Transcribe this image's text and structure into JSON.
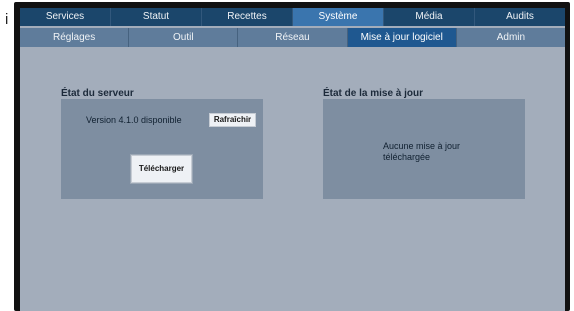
{
  "side_glyph": "i",
  "top_nav": {
    "tabs": [
      {
        "label": "Services",
        "active": false
      },
      {
        "label": "Statut",
        "active": false
      },
      {
        "label": "Recettes",
        "active": false
      },
      {
        "label": "Système",
        "active": true
      },
      {
        "label": "Média",
        "active": false
      },
      {
        "label": "Audits",
        "active": false
      }
    ]
  },
  "sub_nav": {
    "tabs": [
      {
        "label": "Réglages",
        "active": false
      },
      {
        "label": "Outil",
        "active": false
      },
      {
        "label": "Réseau",
        "active": false
      },
      {
        "label": "Mise à jour logiciel",
        "active": true
      },
      {
        "label": "Admin",
        "active": false
      }
    ]
  },
  "server_panel": {
    "title": "État du serveur",
    "message": "Version 4.1.0 disponible",
    "refresh_label": "Rafraîchir",
    "download_label": "Télécharger"
  },
  "update_panel": {
    "title": "État de la mise à jour",
    "message": "Aucune mise à jour téléchargée"
  },
  "colors": {
    "top_nav_bg": "#1b466b",
    "top_nav_active": "#3a75ae",
    "sub_nav_bg": "#5f7c9b",
    "sub_nav_active": "#1f5890",
    "screen_bg": "#a3adbb",
    "panel_bg": "#7e8ea1"
  }
}
